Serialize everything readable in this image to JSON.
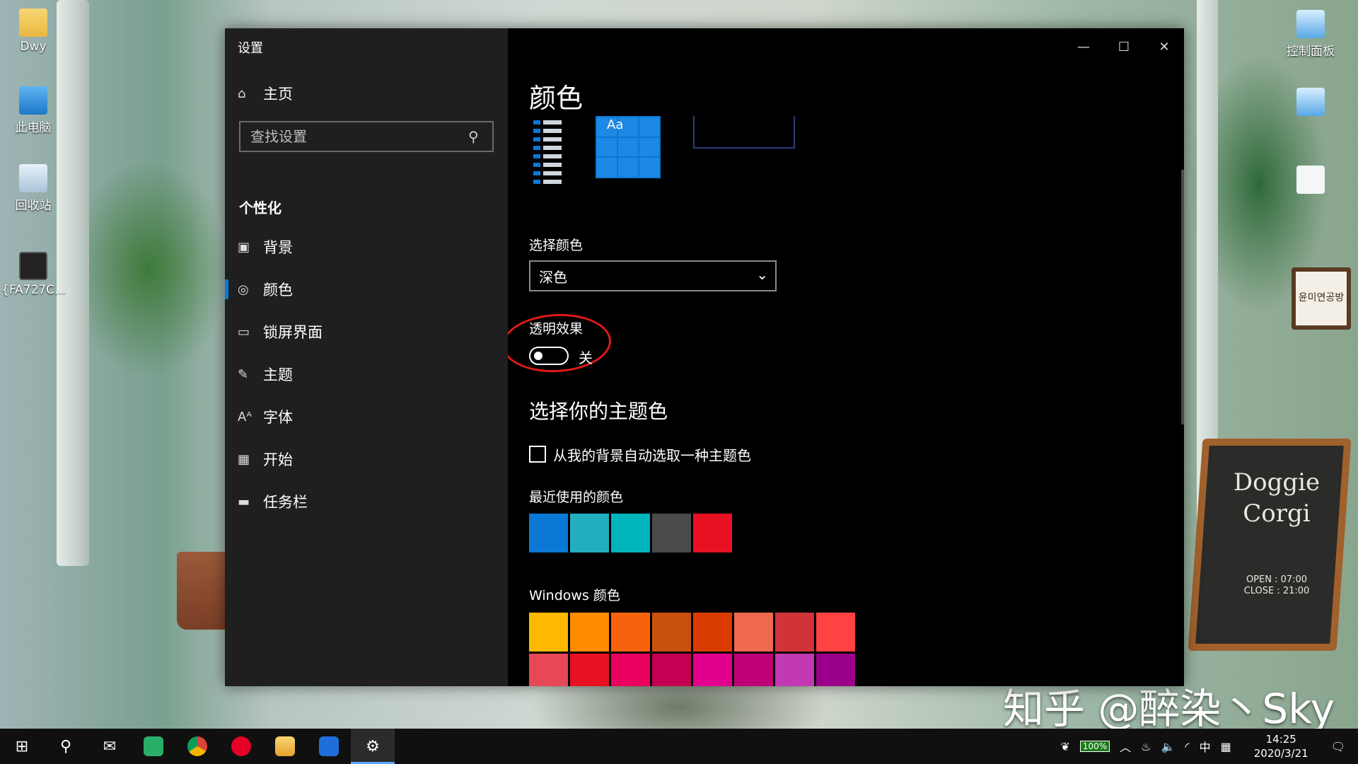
{
  "desktop": {
    "icons": [
      {
        "label": "Dwy",
        "icon": "folder-user-icon"
      },
      {
        "label": "此电脑",
        "icon": "computer-icon"
      },
      {
        "label": "回收站",
        "icon": "recycle-bin-icon"
      },
      {
        "label": "{FA727C...",
        "icon": "video-file-icon"
      },
      {
        "label": "控制面板",
        "icon": "control-panel-icon"
      }
    ],
    "board_text": "Doggie Corgi",
    "board_small": "OPEN : 07:00\nCLOSE : 21:00",
    "sign_text": "윤미연공방",
    "watermark": "知乎 @醉染丶Sky"
  },
  "window": {
    "app_title": "设置",
    "controls": {
      "minimize": "—",
      "maximize": "☐",
      "close": "✕"
    }
  },
  "sidebar": {
    "home": "主页",
    "search_placeholder": "查找设置",
    "group": "个性化",
    "items": [
      {
        "label": "背景",
        "icon": "picture-icon",
        "glyph": "▣"
      },
      {
        "label": "颜色",
        "icon": "palette-icon",
        "glyph": "◎"
      },
      {
        "label": "锁屏界面",
        "icon": "lock-screen-icon",
        "glyph": "▭"
      },
      {
        "label": "主题",
        "icon": "theme-brush-icon",
        "glyph": "✎"
      },
      {
        "label": "字体",
        "icon": "font-icon",
        "glyph": "Aᴬ"
      },
      {
        "label": "开始",
        "icon": "start-grid-icon",
        "glyph": "▦"
      },
      {
        "label": "任务栏",
        "icon": "taskbar-icon",
        "glyph": "▬"
      }
    ],
    "active_item": "颜色"
  },
  "main": {
    "title": "颜色",
    "preview_aa": "Aa",
    "choose_color_label": "选择颜色",
    "choose_color_value": "深色",
    "transparency_label": "透明效果",
    "transparency_state": "关",
    "accent_header": "选择你的主题色",
    "auto_accent_label": "从我的背景自动选取一种主题色",
    "recent_label": "最近使用的颜色",
    "recent_colors": [
      "#0a78d4",
      "#22aebf",
      "#00b4bc",
      "#4c4a48",
      "#e81123"
    ],
    "windows_label": "Windows 颜色",
    "windows_colors_row1": [
      "#ffb900",
      "#ff8c00",
      "#f7630c",
      "#ca5010",
      "#da3b01",
      "#ef6950",
      "#d13438",
      "#ff4343"
    ],
    "windows_colors_row2": [
      "#e74856",
      "#e81123",
      "#ea005e",
      "#c30052",
      "#e3008c",
      "#bf0077",
      "#c239b3",
      "#9a0089"
    ]
  },
  "taskbar": {
    "apps": [
      "windows-start-icon",
      "search-icon",
      "mail-icon",
      "wechat-icon",
      "chrome-icon",
      "netease-music-icon",
      "file-explorer-icon",
      "remote-app-icon",
      "settings-icon"
    ],
    "battery": "100%",
    "ime": "中",
    "time": "14:25",
    "date": "2020/3/21"
  }
}
